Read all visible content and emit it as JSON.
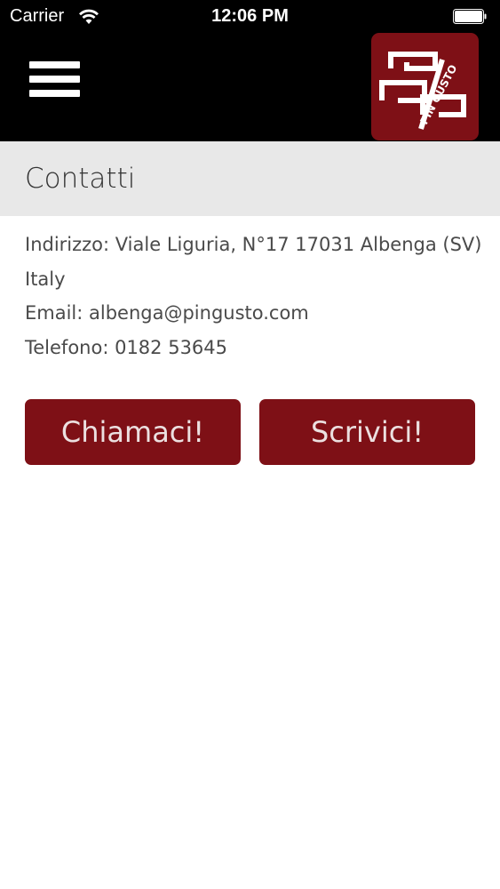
{
  "status_bar": {
    "carrier": "Carrier",
    "time": "12:06 PM",
    "wifi_icon": "wifi-icon",
    "battery_icon": "battery-icon"
  },
  "nav": {
    "menu_icon": "hamburger-menu-icon",
    "logo_text": "PIN GUSTO"
  },
  "page": {
    "title": "Contatti"
  },
  "contact": {
    "address_line1": "Indirizzo: Viale Liguria, N°17 17031 Albenga (SV)",
    "address_line2": "Italy",
    "email": "Email: albenga@pingusto.com",
    "phone": "Telefono: 0182 53645"
  },
  "actions": {
    "call_label": "Chiamaci!",
    "write_label": "Scrivici!"
  },
  "colors": {
    "brand": "#7e1016",
    "header_bg": "#000000",
    "title_bar_bg": "#e8e8e8"
  }
}
